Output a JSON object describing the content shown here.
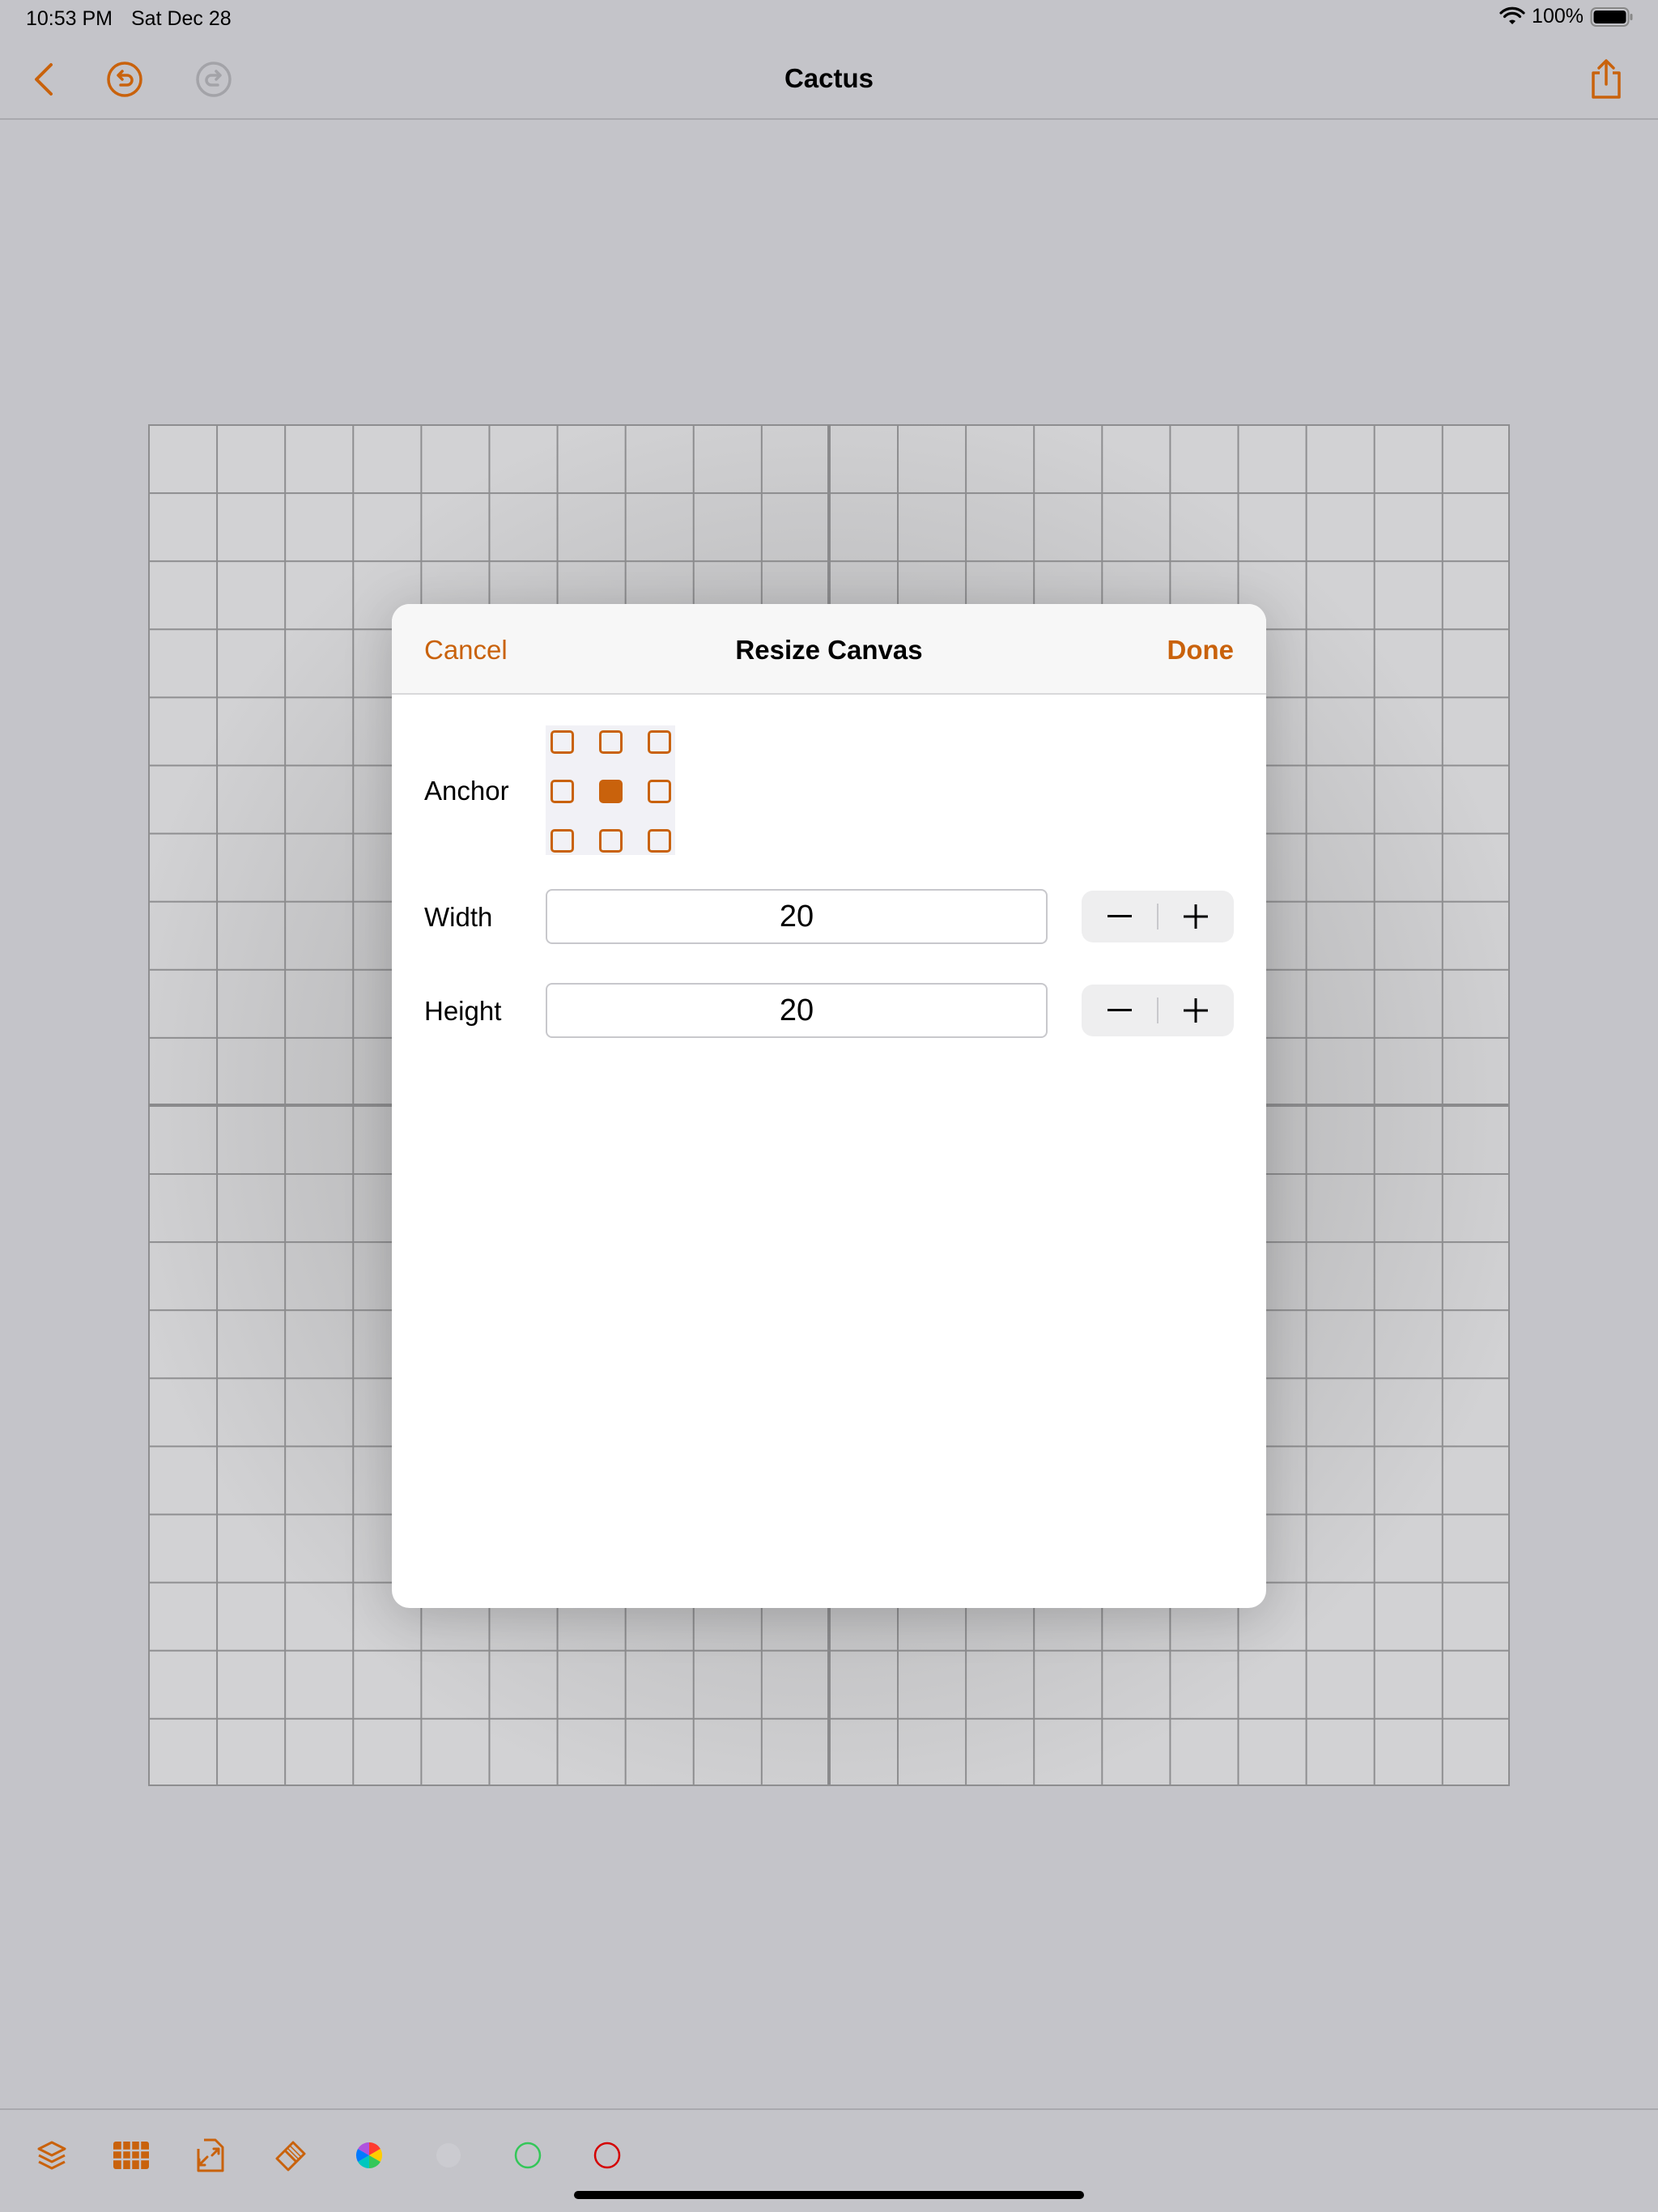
{
  "status_bar": {
    "time": "10:53 PM",
    "date": "Sat Dec 28",
    "battery_percent": "100%"
  },
  "nav": {
    "title": "Cactus",
    "icons": [
      "back-chevron-icon",
      "undo-icon",
      "redo-icon",
      "share-icon"
    ]
  },
  "canvas": {
    "grid_columns": 20,
    "grid_rows": 20
  },
  "modal": {
    "title": "Resize Canvas",
    "cancel_label": "Cancel",
    "done_label": "Done",
    "anchor_label": "Anchor",
    "anchor_selected": "center",
    "width_label": "Width",
    "width_value": "20",
    "height_label": "Height",
    "height_value": "20"
  },
  "toolbar": {
    "icons": [
      "layers-icon",
      "grid-icon",
      "resize-icon",
      "eraser-icon",
      "color-wheel-icon",
      "blank-color-slot",
      "green-color-slot",
      "red-color-slot"
    ]
  },
  "colors": {
    "accent": "#c9620c",
    "background": "#c4c4c9",
    "green_slot": "#34c759",
    "red_slot": "#d40000"
  }
}
